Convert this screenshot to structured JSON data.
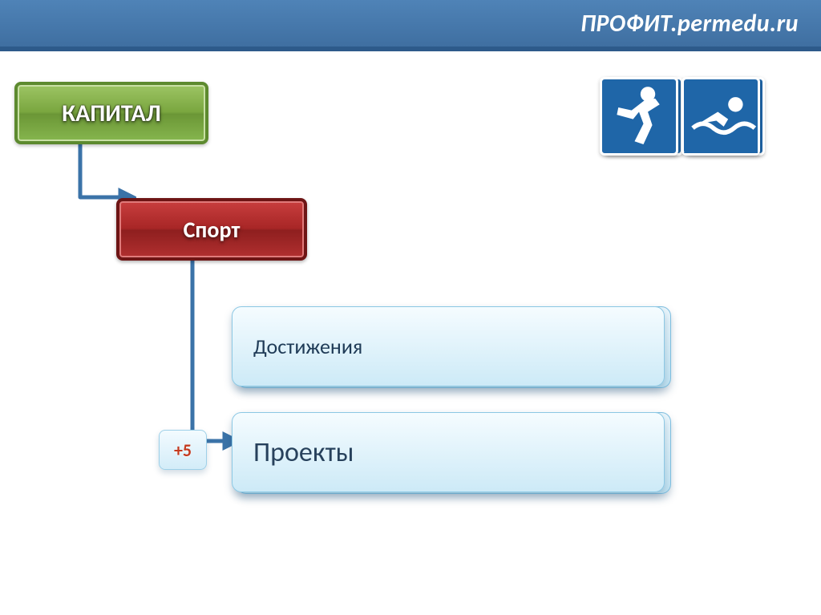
{
  "header": {
    "title": "ПРОФИТ.permedu.ru"
  },
  "nodes": {
    "capital": "КАПИТАЛ",
    "sport": "Спорт",
    "achievements": "Достижения",
    "projects": "Проекты",
    "bonus": "+5"
  },
  "chart_data": {
    "type": "diagram-hierarchy",
    "root": "КАПИТАЛ",
    "edges": [
      {
        "from": "КАПИТАЛ",
        "to": "Спорт"
      },
      {
        "from": "Спорт",
        "to": "Достижения"
      },
      {
        "from": "Спорт",
        "to": "Проекты"
      }
    ],
    "annotations": [
      {
        "text": "+5",
        "attachedTo": "Проекты"
      }
    ],
    "decorative_icons": [
      "karate",
      "weightlifting",
      "running",
      "swimming"
    ]
  }
}
